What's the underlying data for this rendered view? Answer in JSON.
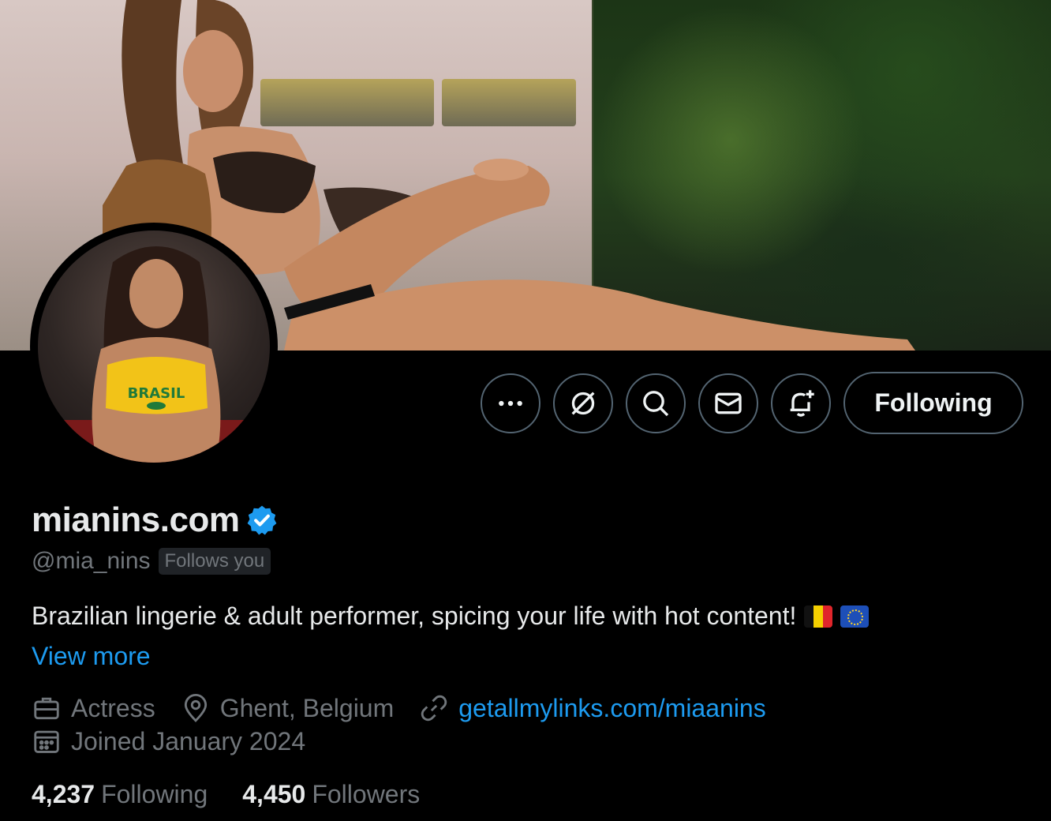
{
  "profile": {
    "display_name": "mianins.com",
    "handle": "@mia_nins",
    "follows_you": "Follows you",
    "bio": "Brazilian lingerie & adult performer, spicing your life with hot content!",
    "bio_emojis": [
      "belgium-flag",
      "eu-flag"
    ],
    "view_more": "View more",
    "profession": "Actress",
    "location": "Ghent, Belgium",
    "website": "getallmylinks.com/miaanins",
    "joined": "Joined January 2024",
    "following_count": "4,237",
    "following_label": "Following",
    "followers_count": "4,450",
    "followers_label": "Followers",
    "avatar_shirt_text": "BRASIL"
  },
  "actions": {
    "more_icon": "more-icon",
    "grok_icon": "grok-icon",
    "search_icon": "search-icon",
    "message_icon": "mail-icon",
    "notify_icon": "bell-plus-icon",
    "follow_label": "Following"
  },
  "colors": {
    "background": "#000000",
    "text": "#e7e9ea",
    "secondary": "#71767b",
    "accent": "#1d9bf0",
    "button_border": "#536471"
  }
}
